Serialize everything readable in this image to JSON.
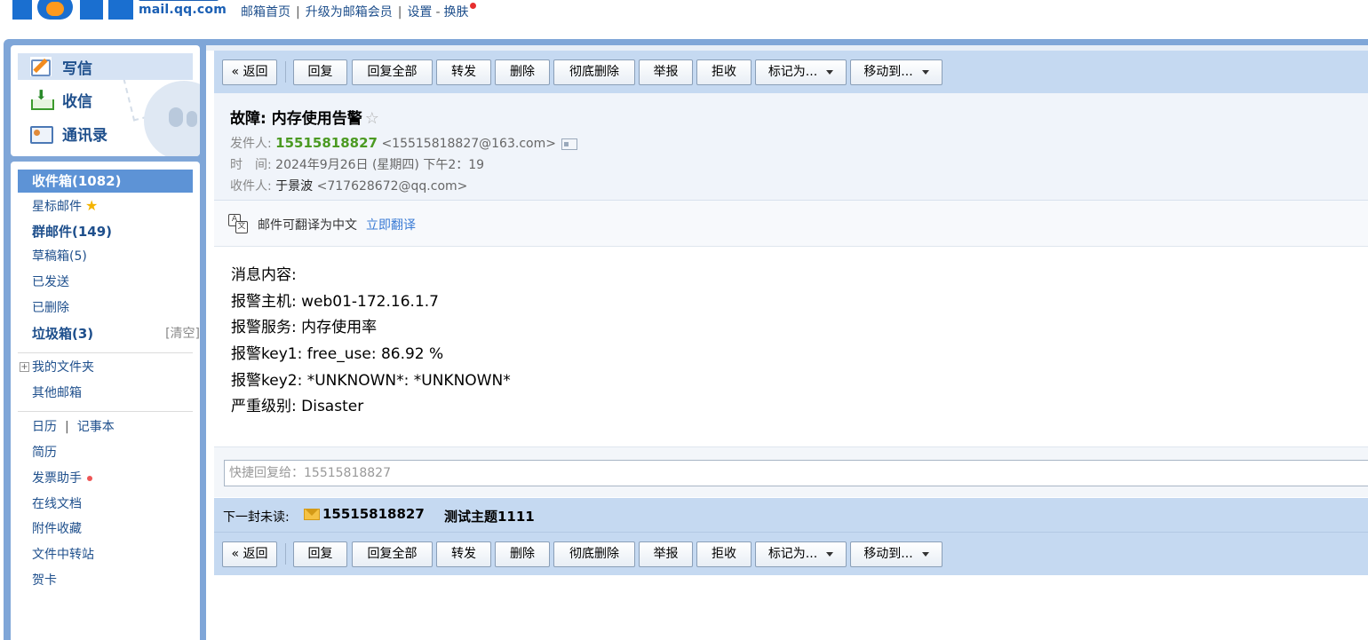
{
  "header": {
    "logo_domain": "mail.qq.com",
    "links": [
      "邮箱首页",
      "升级为邮箱会员",
      "设置",
      "换肤"
    ]
  },
  "sidebar": {
    "main": [
      {
        "label": "写信",
        "icon": "compose-icon"
      },
      {
        "label": "收信",
        "icon": "inbox-download-icon"
      },
      {
        "label": "通讯录",
        "icon": "contacts-card-icon"
      }
    ],
    "folders": {
      "inbox": "收件箱(1082)",
      "starred": "星标邮件",
      "group": "群邮件(149)",
      "drafts": "草稿箱(5)",
      "sent": "已发送",
      "deleted": "已删除",
      "spam": "垃圾箱(3)",
      "spam_clear": "[清空]",
      "my_folders": "我的文件夹",
      "other_mailbox": "其他邮箱",
      "calendar": "日历",
      "notes": "记事本",
      "resume": "简历",
      "invoice": "发票助手",
      "docs": "在线文档",
      "attachments": "附件收藏",
      "transfer": "文件中转站",
      "cards": "贺卡"
    }
  },
  "toolbar": {
    "back": "« 返回",
    "reply": "回复",
    "reply_all": "回复全部",
    "forward": "转发",
    "delete": "删除",
    "delete_permanent": "彻底删除",
    "report": "举报",
    "reject": "拒收",
    "mark_as": "标记为...",
    "move_to": "移动到..."
  },
  "mail": {
    "subject": "故障: 内存使用告警",
    "star": "☆",
    "from_label": "发件人:",
    "from_name": "15515818827",
    "from_addr": "<15515818827@163.com>",
    "time_label": "时　间:",
    "time_value": "2024年9月26日 (星期四) 下午2：19",
    "to_label": "收件人:",
    "to_name": "于景波",
    "to_addr": "<717628672@qq.com>",
    "translate_text": "邮件可翻译为中文",
    "translate_link": "立即翻译",
    "body": [
      "消息内容:",
      "报警主机: web01-172.16.1.7",
      "报警服务: 内存使用率",
      "报警key1: free_use: 86.92 %",
      "报警key2: *UNKNOWN*: *UNKNOWN*",
      "严重级别: Disaster"
    ]
  },
  "quick_reply": {
    "placeholder": "快捷回复给：15515818827"
  },
  "next_unread": {
    "label": "下一封未读:",
    "sender": "15515818827",
    "subject": "测试主题1111"
  }
}
